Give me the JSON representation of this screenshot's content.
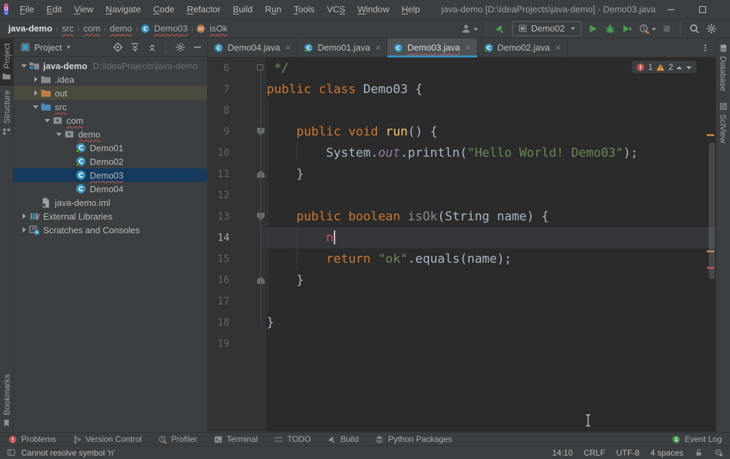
{
  "window": {
    "title": "java-demo [D:\\IdeaProjects\\java-demo] - Demo03.java",
    "logo_text": "IJ"
  },
  "menu": [
    {
      "label": "File",
      "mn": 0
    },
    {
      "label": "Edit",
      "mn": 0
    },
    {
      "label": "View",
      "mn": 0
    },
    {
      "label": "Navigate",
      "mn": 0
    },
    {
      "label": "Code",
      "mn": 0
    },
    {
      "label": "Refactor",
      "mn": 0
    },
    {
      "label": "Build",
      "mn": 0
    },
    {
      "label": "Run",
      "mn": 1
    },
    {
      "label": "Tools",
      "mn": 0
    },
    {
      "label": "VCS",
      "mn": 2
    },
    {
      "label": "Window",
      "mn": 0
    },
    {
      "label": "Help",
      "mn": 0
    }
  ],
  "toolbar": {
    "breadcrumbs": [
      {
        "label": "java-demo",
        "bold": true
      },
      {
        "label": "src",
        "squiggle": true
      },
      {
        "label": "com",
        "squiggle": true
      },
      {
        "label": "demo",
        "squiggle": true
      },
      {
        "label": "Demo03",
        "icon": "class",
        "squiggle": true
      },
      {
        "label": "isOk",
        "icon": "method",
        "squiggle": true
      }
    ],
    "run_config": "Demo02"
  },
  "left_bar": {
    "top": [
      {
        "label": "Project",
        "icon": "folder",
        "active": true
      },
      {
        "label": "Structure",
        "icon": "structure",
        "active": false
      }
    ],
    "bottom": [
      {
        "label": "Bookmarks",
        "icon": "bookmark",
        "active": false
      }
    ]
  },
  "right_bar": [
    {
      "label": "Database",
      "icon": "database"
    },
    {
      "label": "SciView",
      "icon": "grid"
    }
  ],
  "project_panel": {
    "title": "Project",
    "tree": [
      {
        "depth": 0,
        "chevron": "open",
        "icon": "project-folder",
        "label": "java-demo",
        "bold": true,
        "path": "D:\\IdeaProjects\\java-demo"
      },
      {
        "depth": 1,
        "chevron": "closed",
        "icon": "folder",
        "label": ".idea"
      },
      {
        "depth": 1,
        "chevron": "closed",
        "icon": "folder-excluded",
        "label": "out",
        "hovered": true
      },
      {
        "depth": 1,
        "chevron": "open",
        "icon": "folder-source",
        "label": "src",
        "squiggle": true
      },
      {
        "depth": 2,
        "chevron": "open",
        "icon": "package",
        "label": "com",
        "squiggle": true
      },
      {
        "depth": 3,
        "chevron": "open",
        "icon": "package",
        "label": "demo",
        "squiggle": true
      },
      {
        "depth": 4,
        "chevron": "none",
        "icon": "class-run",
        "label": "Demo01"
      },
      {
        "depth": 4,
        "chevron": "none",
        "icon": "class-run",
        "label": "Demo02"
      },
      {
        "depth": 4,
        "chevron": "none",
        "icon": "class",
        "label": "Demo03",
        "selected": true,
        "squiggle": true
      },
      {
        "depth": 4,
        "chevron": "none",
        "icon": "class",
        "label": "Demo04"
      },
      {
        "depth": 1,
        "chevron": "none",
        "icon": "file-iml",
        "label": "java-demo.iml"
      },
      {
        "depth": 0,
        "chevron": "closed",
        "icon": "library",
        "label": "External Libraries"
      },
      {
        "depth": 0,
        "chevron": "closed",
        "icon": "scratches",
        "label": "Scratches and Consoles"
      }
    ]
  },
  "editor": {
    "tabs": [
      {
        "label": "Demo04.java",
        "icon": "class",
        "active": false,
        "squiggle": false
      },
      {
        "label": "Demo01.java",
        "icon": "class-run",
        "active": false,
        "squiggle": false
      },
      {
        "label": "Demo03.java",
        "icon": "class",
        "active": true,
        "squiggle": true
      },
      {
        "label": "Demo02.java",
        "icon": "class-run",
        "active": false,
        "squiggle": false
      }
    ],
    "inspections": {
      "errors": "1",
      "warnings": "2"
    },
    "code": {
      "first_line": 6,
      "caret_line": 14,
      "lines": [
        {
          "n": 6,
          "fold": "box",
          "seg": [
            [
              " */",
              "comment"
            ]
          ]
        },
        {
          "n": 7,
          "seg": [
            [
              "public ",
              "kw"
            ],
            [
              "class ",
              "kw"
            ],
            [
              "Demo03 {",
              "plain"
            ]
          ]
        },
        {
          "n": 8,
          "seg": []
        },
        {
          "n": 9,
          "fold": "open",
          "seg": [
            [
              "    ",
              "plain"
            ],
            [
              "public ",
              "kw"
            ],
            [
              "void ",
              "kw"
            ],
            [
              "run",
              "mdecl"
            ],
            [
              "() {",
              "plain"
            ]
          ]
        },
        {
          "n": 10,
          "seg": [
            [
              "        ",
              "plain"
            ],
            [
              "System.",
              "plain"
            ],
            [
              "out",
              "field"
            ],
            [
              ".println(",
              "plain"
            ],
            [
              "\"Hello World! Demo03\"",
              "str"
            ],
            [
              ");",
              "plain"
            ]
          ]
        },
        {
          "n": 11,
          "fold": "close",
          "seg": [
            [
              "    }",
              "plain"
            ]
          ]
        },
        {
          "n": 12,
          "seg": []
        },
        {
          "n": 13,
          "fold": "open",
          "seg": [
            [
              "    ",
              "plain"
            ],
            [
              "public ",
              "kw"
            ],
            [
              "boolean ",
              "kw"
            ],
            [
              "isOk",
              "gray"
            ],
            [
              "(String name) {",
              "plain"
            ]
          ]
        },
        {
          "n": 14,
          "caret": true,
          "seg": [
            [
              "        ",
              "plain"
            ],
            [
              "n",
              "err"
            ]
          ]
        },
        {
          "n": 15,
          "seg": [
            [
              "        ",
              "plain"
            ],
            [
              "return ",
              "kw"
            ],
            [
              "\"ok\"",
              "str"
            ],
            [
              ".equals(name);",
              "plain"
            ]
          ]
        },
        {
          "n": 16,
          "fold": "close",
          "seg": [
            [
              "    }",
              "plain"
            ]
          ]
        },
        {
          "n": 17,
          "seg": []
        },
        {
          "n": 18,
          "seg": [
            [
              "}",
              "plain"
            ]
          ]
        },
        {
          "n": 19,
          "seg": []
        }
      ]
    }
  },
  "bottom_bar": {
    "left": [
      {
        "label": "Problems",
        "icon": "error"
      },
      {
        "label": "Version Control",
        "icon": "branch"
      },
      {
        "label": "Profiler",
        "icon": "profiler"
      },
      {
        "label": "Terminal",
        "icon": "terminal"
      },
      {
        "label": "TODO",
        "icon": "todo"
      },
      {
        "label": "Build",
        "icon": "hammer-gray"
      },
      {
        "label": "Python Packages",
        "icon": "packages"
      }
    ],
    "right": [
      {
        "label": "Event Log",
        "icon": "event"
      }
    ]
  },
  "status_bar": {
    "message": "Cannot resolve symbol 'n'",
    "caret_pos": "14:10",
    "line_ending": "CRLF",
    "encoding": "UTF-8",
    "indent": "4 spaces"
  }
}
